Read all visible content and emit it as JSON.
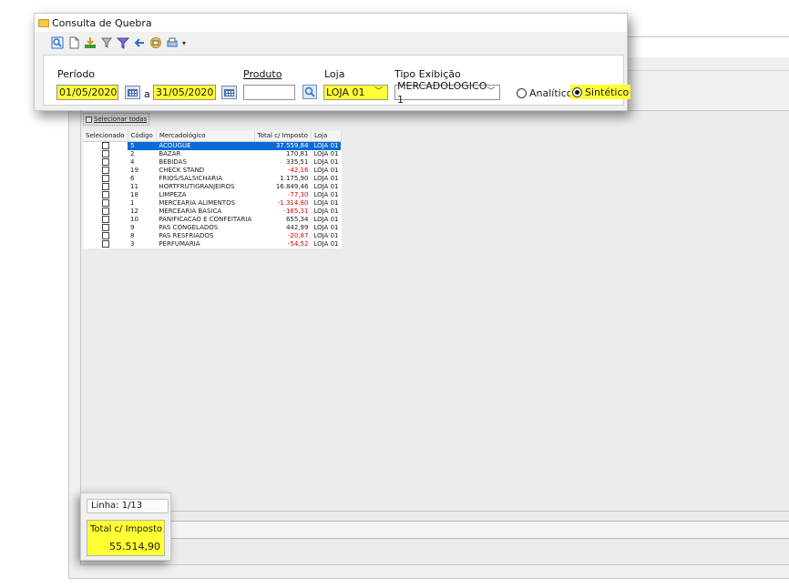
{
  "window": {
    "title": "Consulta de Quebra"
  },
  "toolbar": {
    "icons": [
      "preview-icon",
      "new-document-icon",
      "export-icon",
      "filter-toggle-icon",
      "funnel-filter-icon",
      "back-arrow-icon",
      "print-icon",
      "print-options-icon",
      "dropdown-arrow-icon"
    ]
  },
  "filters": {
    "periodo_label": "Período",
    "date_from": "01/05/2020",
    "date_sep": "a",
    "date_to": "31/05/2020",
    "produto_label": "Produto",
    "produto_value": "",
    "loja_label": "Loja",
    "loja_value": "LOJA 01",
    "tipo_label": "Tipo Exibição",
    "tipo_value": "MERCADOLOGICO 1",
    "radio_analitico": "Analítico",
    "radio_sintetico": "Sintético",
    "radio_selected": "Sintético"
  },
  "grid": {
    "select_all_label": "Selecionar todas",
    "columns": [
      "Selecionado",
      "Código",
      "Mercadológico",
      "Total c/ Imposto",
      "Loja"
    ],
    "rows": [
      {
        "codigo": "5",
        "mercadologico": "ACOUGUE",
        "total": "37.559,84",
        "loja": "LOJA 01",
        "negative": false,
        "selected": true
      },
      {
        "codigo": "2",
        "mercadologico": "BAZAR",
        "total": "170,81",
        "loja": "LOJA 01",
        "negative": false,
        "selected": false
      },
      {
        "codigo": "4",
        "mercadologico": "BEBIDAS",
        "total": "335,51",
        "loja": "LOJA 01",
        "negative": false,
        "selected": false
      },
      {
        "codigo": "19",
        "mercadologico": "CHECK STAND",
        "total": "-42,16",
        "loja": "LOJA 01",
        "negative": true,
        "selected": false
      },
      {
        "codigo": "6",
        "mercadologico": "FRIOS/SALSICHARIA",
        "total": "1.175,90",
        "loja": "LOJA 01",
        "negative": false,
        "selected": false
      },
      {
        "codigo": "11",
        "mercadologico": "HORTFRUTIGRANJEIROS",
        "total": "16.849,46",
        "loja": "LOJA 01",
        "negative": false,
        "selected": false
      },
      {
        "codigo": "18",
        "mercadologico": "LIMPEZA",
        "total": "-77,30",
        "loja": "LOJA 01",
        "negative": true,
        "selected": false
      },
      {
        "codigo": "1",
        "mercadologico": "MERCEARIA ALIMENTOS",
        "total": "-1.314,80",
        "loja": "LOJA 01",
        "negative": true,
        "selected": false
      },
      {
        "codigo": "12",
        "mercadologico": "MERCEARIA BASICA",
        "total": "-165,31",
        "loja": "LOJA 01",
        "negative": true,
        "selected": false
      },
      {
        "codigo": "10",
        "mercadologico": "PANIFICACAO E CONFEITARIA",
        "total": "655,34",
        "loja": "LOJA 01",
        "negative": false,
        "selected": false
      },
      {
        "codigo": "9",
        "mercadologico": "PAS CONGELADOS",
        "total": "442,99",
        "loja": "LOJA 01",
        "negative": false,
        "selected": false
      },
      {
        "codigo": "8",
        "mercadologico": "PAS RESFRIADOS",
        "total": "-20,87",
        "loja": "LOJA 01",
        "negative": true,
        "selected": false
      },
      {
        "codigo": "3",
        "mercadologico": "PERFUMARIA",
        "total": "-54,52",
        "loja": "LOJA 01",
        "negative": true,
        "selected": false
      }
    ]
  },
  "footer": {
    "linha": "Linha: 1/13",
    "total_label": "Total c/ Imposto",
    "total_value": "55.514,90"
  },
  "colors": {
    "highlight": "#ffff33",
    "selection": "#0a6ad6",
    "negative": "#e00000"
  }
}
